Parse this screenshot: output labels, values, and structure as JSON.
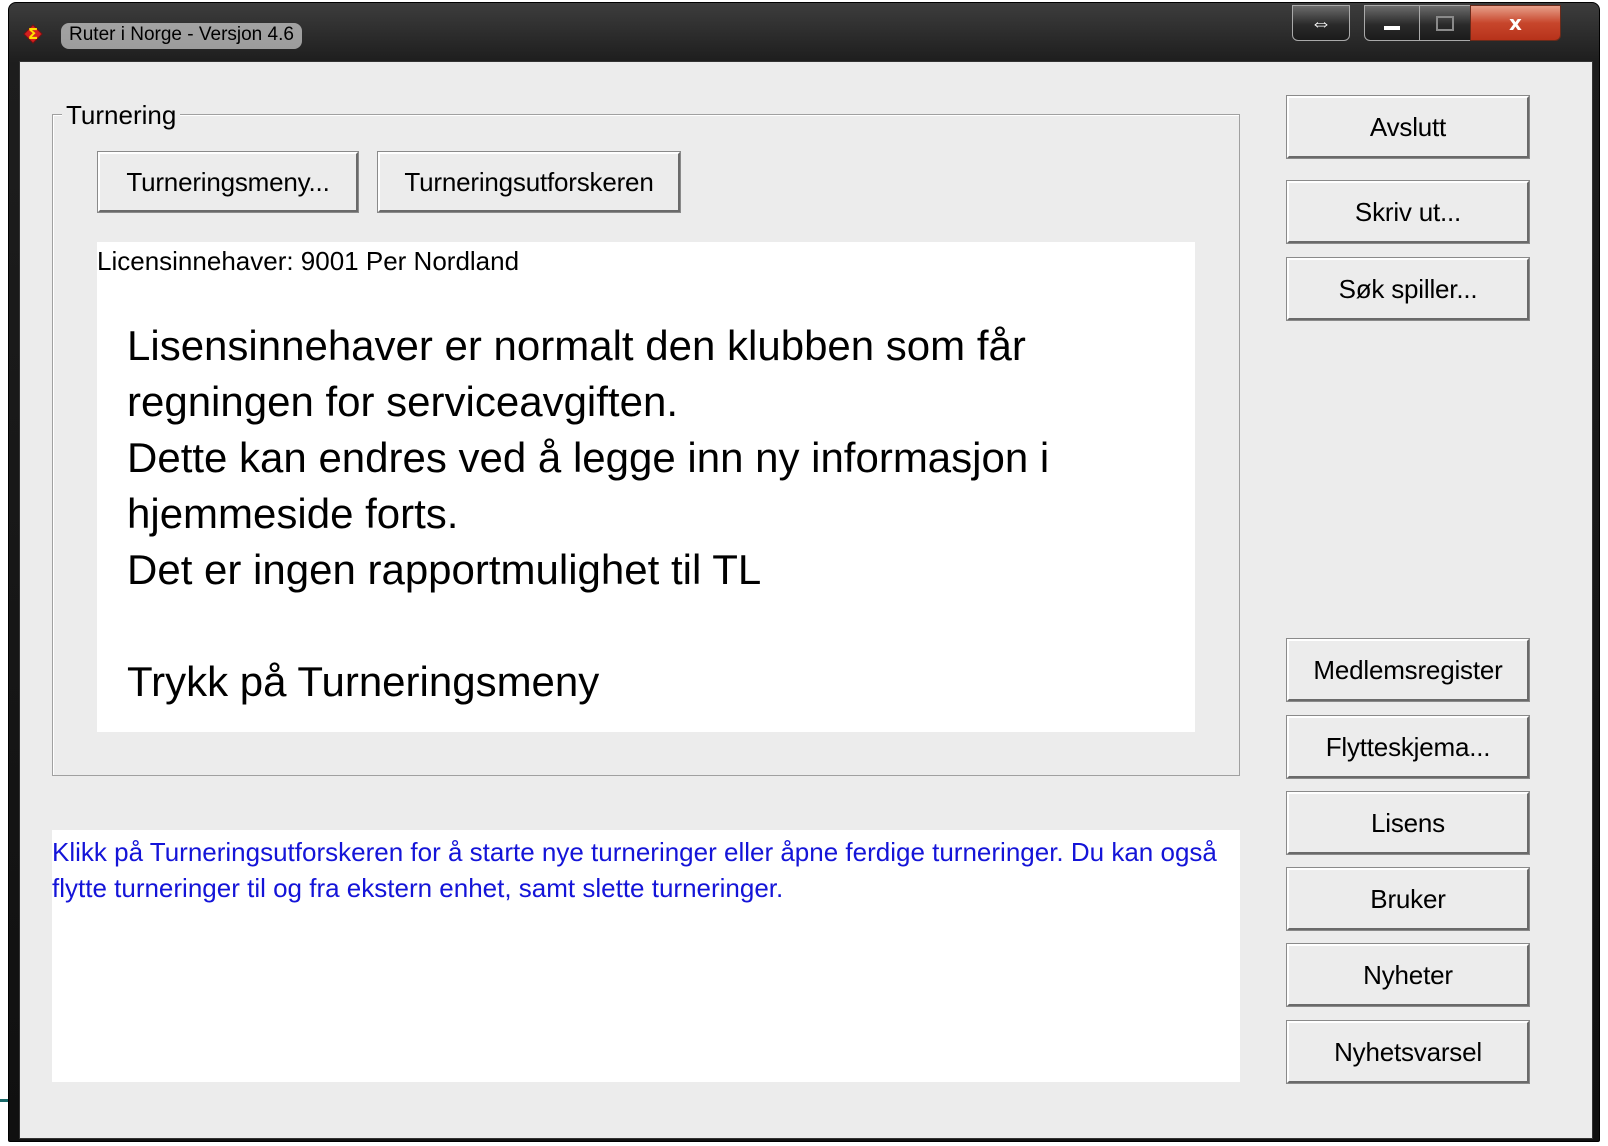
{
  "window": {
    "title": "Ruter i Norge - Versjon 4.6",
    "caption_buttons": {
      "resize_symbol": "⇔",
      "minimize_symbol": "▁",
      "maximize_symbol": "▫",
      "close_symbol": "x"
    }
  },
  "tournament_group": {
    "legend": "Turnering",
    "buttons": {
      "menu": "Turneringsmeny...",
      "explorer": "Turneringsutforskeren"
    },
    "license_holder": "Licensinnehaver: 9001 Per Nordland",
    "info_lines": [
      "Lisensinnehaver er normalt den klubben som får",
      "regningen for serviceavgiften.",
      "Dette kan endres ved å legge inn ny informasjon i",
      "hjemmeside forts.",
      "Det er ingen rapportmulighet til TL",
      "",
      "Trykk på Turneringsmeny"
    ]
  },
  "help_text": "Klikk på Turneringsutforskeren for å starte nye turneringer eller åpne ferdige turneringer. Du kan også flytte turneringer til og fra ekstern enhet, samt slette turneringer.",
  "side_buttons": {
    "quit": "Avslutt",
    "print": "Skriv ut...",
    "search_player": "Søk spiller...",
    "member_register": "Medlemsregister",
    "transfer_form": "Flytteskjema...",
    "license": "Lisens",
    "user": "Bruker",
    "news": "Nyheter",
    "news_alert": "Nyhetsvarsel"
  },
  "colors": {
    "help_text": "#1414d8",
    "window_face": "#ececec",
    "titlebar": "#1d1d1d",
    "close_button": "#c7462c"
  },
  "icons": {
    "app": "sigma-app-icon",
    "resize": "resize-arrows-icon"
  }
}
